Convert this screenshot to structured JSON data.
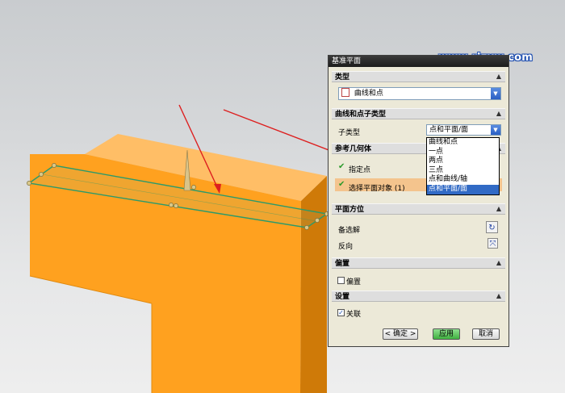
{
  "watermark": "www.rjzxw.com",
  "dialog": {
    "title": "基准平面",
    "type_section": {
      "header": "类型",
      "selected": "曲线和点"
    },
    "subtype_section": {
      "header": "曲线和点子类型",
      "label": "子类型",
      "selected": "点和平面/面",
      "options": [
        "曲线和点",
        "一点",
        "两点",
        "三点",
        "点和曲线/轴",
        "点和平面/面"
      ],
      "selected_index": 5
    },
    "reference_section": {
      "header": "参考几何体",
      "row1": "指定点",
      "row2": "选择平面对象 (1)"
    },
    "orientation_section": {
      "header": "平面方位",
      "row1": "备选解",
      "row2": "反向"
    },
    "offset_section": {
      "header": "偏置",
      "checkbox_label": "偏置",
      "checked": false
    },
    "settings_section": {
      "header": "设置",
      "checkbox_label": "关联",
      "checked": true
    },
    "buttons": {
      "ok": "< 确定 >",
      "apply": "应用",
      "cancel": "取消"
    }
  },
  "colors": {
    "part_front": "#ffa11f",
    "part_top": "#ffbe66",
    "part_side": "#cf7a08",
    "plane_outline": "#2c9a6a",
    "annotation_arrow": "#dd1f1f",
    "dropdown_selection": "#316ac5"
  }
}
